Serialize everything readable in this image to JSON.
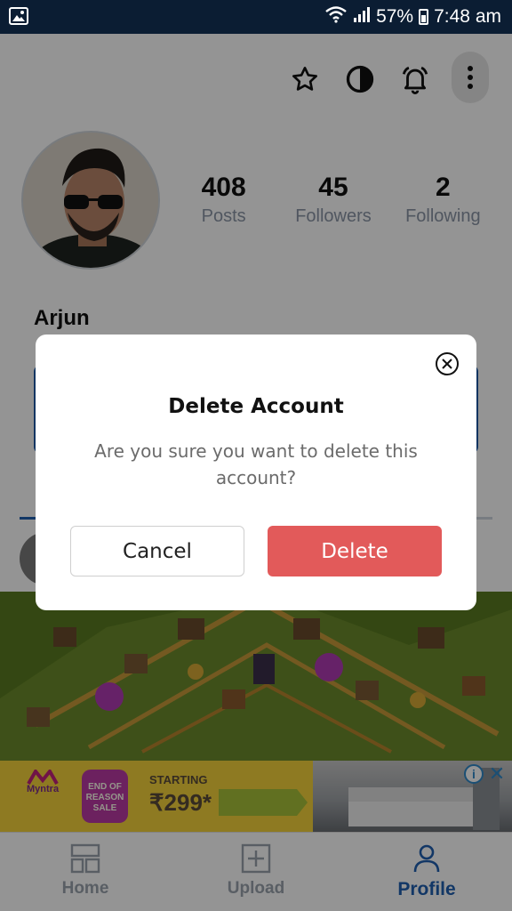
{
  "status_bar": {
    "battery_percent": "57%",
    "time": "7:48 am",
    "icons": [
      "image-icon",
      "wifi-icon",
      "signal-icon",
      "battery-icon"
    ]
  },
  "toolbar": {
    "icons": [
      "star-icon",
      "theme-icon",
      "bell-icon",
      "more-vertical-icon"
    ]
  },
  "profile": {
    "name": "Arjun",
    "stats": [
      {
        "value": "408",
        "label": "Posts"
      },
      {
        "value": "45",
        "label": "Followers"
      },
      {
        "value": "2",
        "label": "Following"
      }
    ]
  },
  "ad": {
    "brand": "Myntra",
    "sale_badge": "END OF REASON SALE",
    "starting_label": "STARTING",
    "price": "₹299*"
  },
  "bottom_nav": {
    "items": [
      {
        "label": "Home",
        "icon": "home-icon",
        "active": false
      },
      {
        "label": "Upload",
        "icon": "upload-icon",
        "active": false
      },
      {
        "label": "Profile",
        "icon": "profile-icon",
        "active": true
      }
    ]
  },
  "dialog": {
    "title": "Delete Account",
    "message": "Are you sure you want to delete this account?",
    "cancel_label": "Cancel",
    "delete_label": "Delete",
    "delete_color": "#e25a5a"
  },
  "colors": {
    "accent": "#1f5fb0",
    "status_bar": "#0b1d33"
  }
}
